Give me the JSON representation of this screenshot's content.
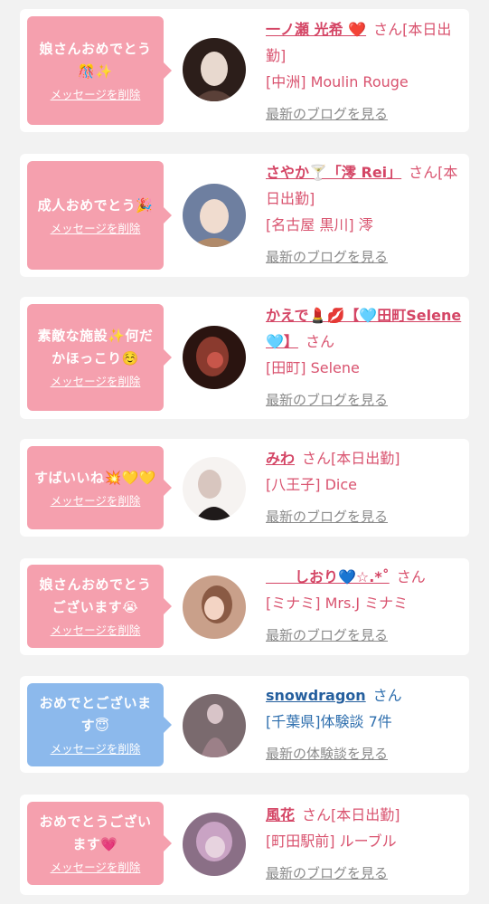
{
  "entries": [
    {
      "message": "娘さんおめでとう🎊✨",
      "delete_label": "メッセージを削除",
      "name": "一ノ瀬 光希 ❤️",
      "suffix": "さん[本日出勤]",
      "shop": "[中洲] Moulin Rouge",
      "blog": "最新のブログを見る",
      "avatar_colors": [
        "#e8d9cf",
        "#5a4038",
        "#2c1e1a"
      ]
    },
    {
      "message": "成人おめでとう🎉",
      "delete_label": "メッセージを削除",
      "name": "さやか🍸「澪 Rei」",
      "suffix": "さん[本日出勤]",
      "shop": "[名古屋 黒川] 澪",
      "blog": "最新のブログを見る",
      "avatar_colors": [
        "#f0dccf",
        "#b08a6a",
        "#6e7fa0"
      ]
    },
    {
      "message": "素敵な施設✨何だかほっこり☺️",
      "delete_label": "メッセージを削除",
      "name": "かえで💄💋【🩵田町Selene🩵】",
      "suffix": "さん",
      "shop": "[田町] Selene",
      "blog": "最新のブログを見る",
      "avatar_colors": [
        "#8a3a2e",
        "#c8564a",
        "#2a1410"
      ]
    },
    {
      "message": "すばいいね💥💛💛",
      "delete_label": "メッセージを削除",
      "name": "みわ",
      "suffix": "さん[本日出勤]",
      "shop": "[八王子] Dice",
      "blog": "最新のブログを見る",
      "avatar_colors": [
        "#f6f3f1",
        "#d8c6bf",
        "#1f1a1a"
      ]
    },
    {
      "message": "娘さんおめでとうございます😭",
      "delete_label": "メッセージを削除",
      "name": "　　しおり💙☆.*˚",
      "suffix": "さん",
      "shop": "[ミナミ] Mrs.J ミナミ",
      "blog": "最新のブログを見る",
      "avatar_colors": [
        "#f3d4c4",
        "#8a5a44",
        "#c9a08a"
      ]
    },
    {
      "message": "おめでとございます😇",
      "delete_label": "メッセージを削除",
      "name": "snowdragon",
      "suffix": "さん",
      "shop": "[千葉県]体験談 7件",
      "blog": "最新の体験談を見る",
      "avatar_colors": [
        "#d8c4c8",
        "#9c8088",
        "#7a6a6e"
      ]
    },
    {
      "message": "おめでとうございます💗",
      "delete_label": "メッセージを削除",
      "name": "風花",
      "suffix": "さん[本日出勤]",
      "shop": "[町田駅前] ルーブル",
      "blog": "最新のブログを見る",
      "avatar_colors": [
        "#e7d3df",
        "#c9a3c4",
        "#8a6f86"
      ]
    }
  ]
}
